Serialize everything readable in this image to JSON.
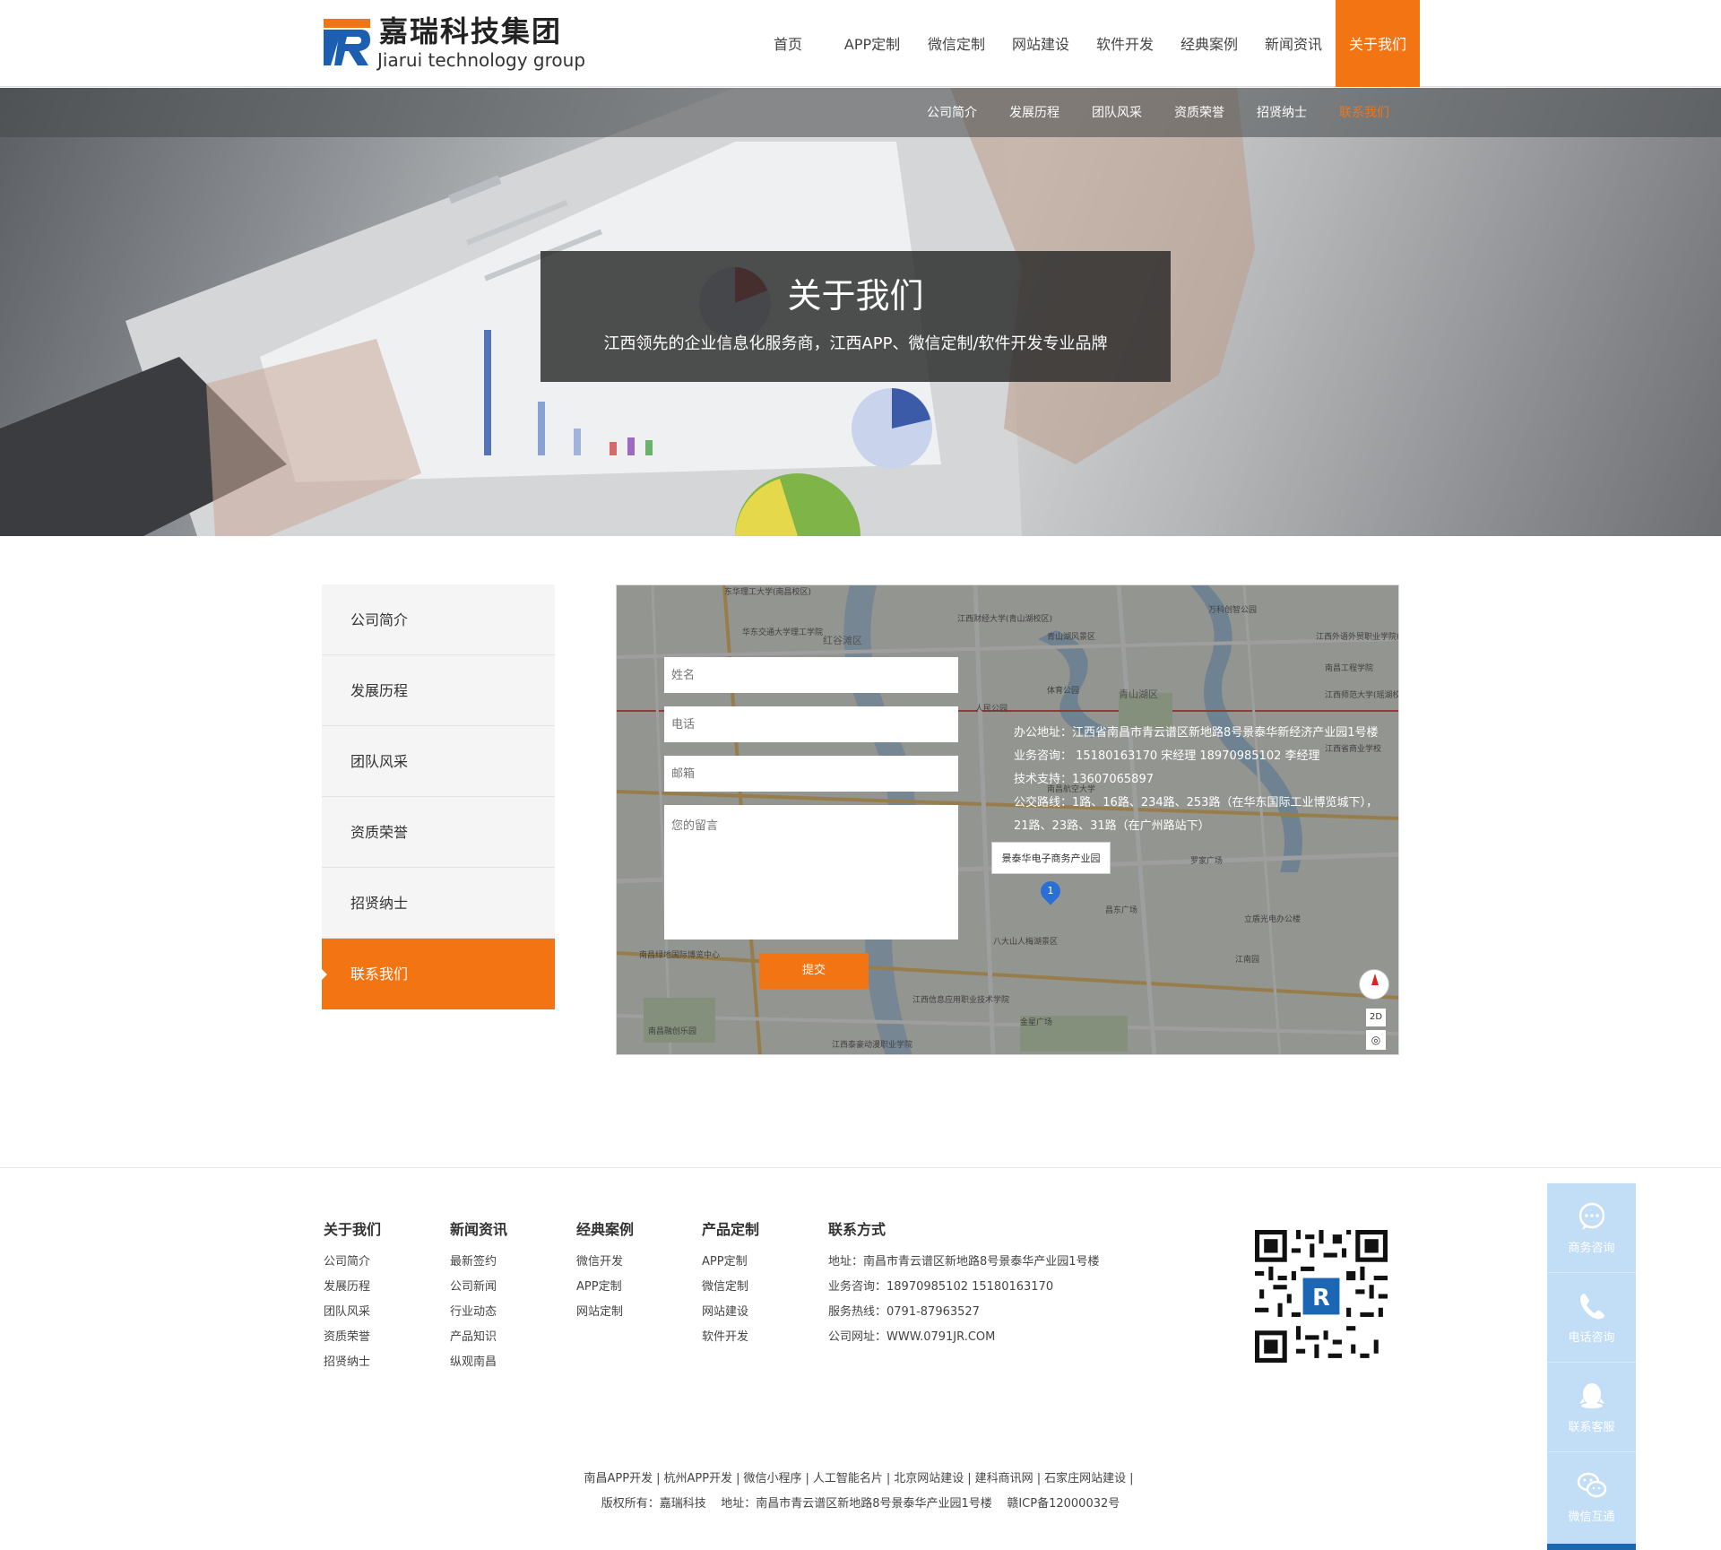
{
  "header": {
    "logo_cn": "嘉瑞科技集团",
    "logo_en": "Jiarui technology group",
    "nav": [
      "首页",
      "APP定制",
      "微信定制",
      "网站建设",
      "软件开发",
      "经典案例",
      "新闻资讯",
      "关于我们"
    ],
    "active_nav": "关于我们"
  },
  "colors": {
    "accent": "#f27413",
    "float_panel": "#c2ddf6",
    "float_bar": "#1c67b4"
  },
  "subnav": {
    "items": [
      "公司简介",
      "发展历程",
      "团队风采",
      "资质荣誉",
      "招贤纳士",
      "联系我们"
    ],
    "active": "联系我们"
  },
  "banner": {
    "title": "关于我们",
    "subtitle": "江西领先的企业信息化服务商，江西APP、微信定制/软件开发专业品牌"
  },
  "sidebar": {
    "items": [
      "公司简介",
      "发展历程",
      "团队风采",
      "资质荣誉",
      "招贤纳士",
      "联系我们"
    ],
    "active": "联系我们"
  },
  "form": {
    "name_placeholder": "姓名",
    "phone_placeholder": "电话",
    "email_placeholder": "邮箱",
    "message_placeholder": "您的留言",
    "submit_label": "提交"
  },
  "contact": {
    "address": "办公地址：江西省南昌市青云谱区新地路8号景泰华新经济产业园1号楼",
    "business": "业务咨询：  15180163170  宋经理     18970985102 李经理",
    "tech": "技术支持：13607065897",
    "bus": "公交路线：1路、16路、234路、253路（在华东国际工业博览城下），21路、23路、31路（在广州路站下）"
  },
  "map": {
    "pin_label": "景泰华电子商务产业园",
    "pin_number": "1",
    "place_labels": [
      "东华理工大学(南昌校区)",
      "华东交通大学理工学院",
      "红谷滩区",
      "江西财经大学(青山湖校区)",
      "万科创智公园",
      "江西外语外贸职业学院(瑶湖校区)",
      "南昌工程学院",
      "青山湖区",
      "人民公园",
      "体育公园",
      "青山湖风景区",
      "江西师范大学(瑶湖校区)",
      "南昌航空大学",
      "罗家广场",
      "江西省商业学校",
      "南昌绿地国际博览中心",
      "江西泰豪动漫职业学院",
      "江西信息应用职业技术学院",
      "八大山人梅湖景区",
      "昌东广场",
      "立盾光电办公楼",
      "江南园",
      "金星广场",
      "南昌融创乐园"
    ],
    "mode_label": "2D"
  },
  "footer": {
    "columns": [
      {
        "title": "关于我们",
        "links": [
          "公司简介",
          "发展历程",
          "团队风采",
          "资质荣誉",
          "招贤纳士"
        ]
      },
      {
        "title": "新闻资讯",
        "links": [
          "最新签约",
          "公司新闻",
          "行业动态",
          "产品知识",
          "纵观南昌"
        ]
      },
      {
        "title": "经典案例",
        "links": [
          "微信开发",
          "APP定制",
          "网站定制"
        ]
      },
      {
        "title": "产品定制",
        "links": [
          "APP定制",
          "微信定制",
          "网站建设",
          "软件开发"
        ]
      }
    ],
    "contact_title": "联系方式",
    "contact_lines": [
      "地址：南昌市青云谱区新地路8号景泰华产业园1号楼",
      "业务咨询：18970985102 15180163170",
      "服务热线：0791-87963527",
      "公司网址：WWW.0791JR.COM"
    ],
    "bottom_links": [
      "南昌APP开发",
      "杭州APP开发",
      "微信小程序",
      "人工智能名片",
      "北京网站建设",
      "建科商讯网",
      "石家庄网站建设"
    ],
    "copyright": "版权所有：嘉瑞科技    地址：南昌市青云谱区新地路8号景泰华产业园1号楼    赣ICP备12000032号"
  },
  "float_panel": {
    "items": [
      {
        "label": "商务咨询",
        "icon": "chat-bubble-icon"
      },
      {
        "label": "电话咨询",
        "icon": "phone-icon"
      },
      {
        "label": "联系客服",
        "icon": "qq-icon"
      },
      {
        "label": "微信互通",
        "icon": "wechat-icon"
      }
    ]
  }
}
